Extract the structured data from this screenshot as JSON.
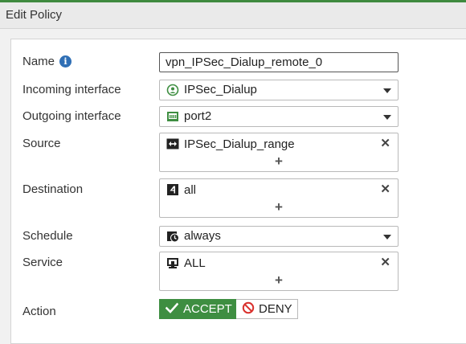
{
  "window": {
    "title": "Edit Policy"
  },
  "form": {
    "name": {
      "label": "Name",
      "value": "vpn_IPSec_Dialup_remote_0"
    },
    "incoming_interface": {
      "label": "Incoming interface",
      "value": "IPSec_Dialup",
      "icon": "tunnel-interface-icon"
    },
    "outgoing_interface": {
      "label": "Outgoing interface",
      "value": "port2",
      "icon": "port-icon"
    },
    "source": {
      "label": "Source",
      "value": "IPSec_Dialup_range",
      "icon": "address-range-icon",
      "add": "+",
      "remove": "✕"
    },
    "destination": {
      "label": "Destination",
      "value": "all",
      "icon": "address-icon",
      "add": "+",
      "remove": "✕"
    },
    "schedule": {
      "label": "Schedule",
      "value": "always",
      "icon": "calendar-clock-icon"
    },
    "service": {
      "label": "Service",
      "value": "ALL",
      "icon": "service-icon",
      "add": "+",
      "remove": "✕"
    },
    "action": {
      "label": "Action",
      "accept_label": "ACCEPT",
      "deny_label": "DENY",
      "selected": "ACCEPT"
    }
  },
  "colors": {
    "accent_green": "#3e8e41",
    "deny_red": "#d9302c",
    "info_blue": "#2f6fb5",
    "header_line": "#3f8a3f"
  }
}
